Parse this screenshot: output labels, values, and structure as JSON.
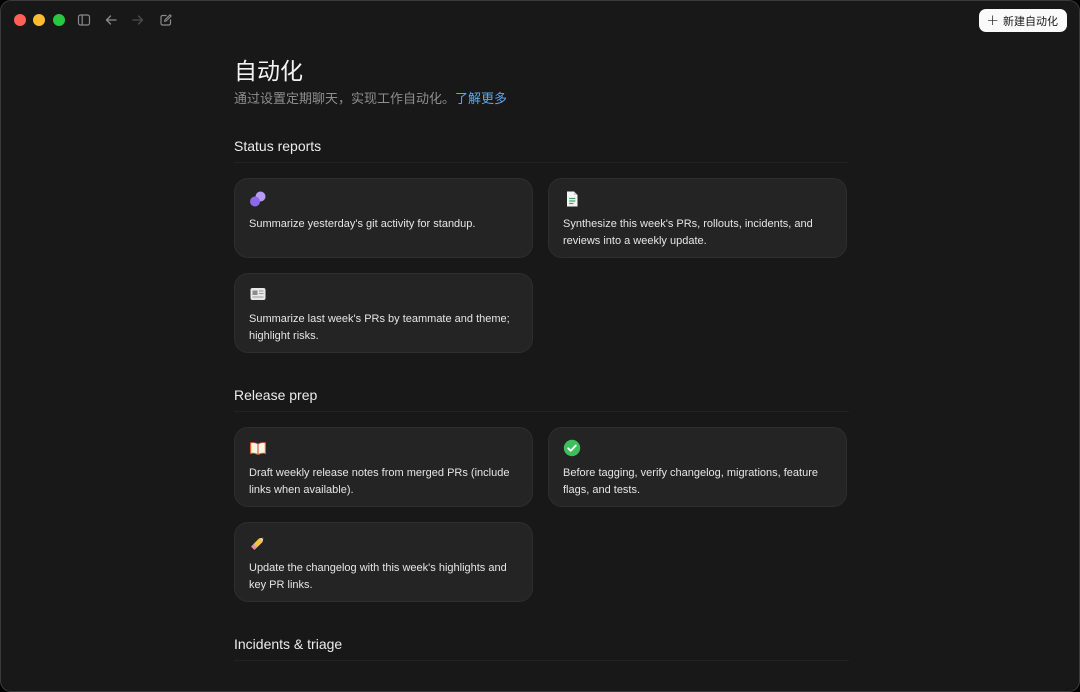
{
  "header": {
    "new_button_label": "新建自动化"
  },
  "page": {
    "title": "自动化",
    "subtitle": "通过设置定期聊天，实现工作自动化。",
    "learn_more": "了解更多"
  },
  "sections": [
    {
      "title": "Status reports",
      "cards": [
        {
          "icon": "chat-bubbles-icon",
          "text": "Summarize yesterday's git activity for standup."
        },
        {
          "icon": "document-icon",
          "text": "Synthesize this week's PRs, rollouts, incidents, and reviews into a weekly update."
        },
        {
          "icon": "newspaper-icon",
          "text": "Summarize last week's PRs by teammate and theme; highlight risks."
        }
      ]
    },
    {
      "title": "Release prep",
      "cards": [
        {
          "icon": "open-book-icon",
          "text": "Draft weekly release notes from merged PRs (include links when available)."
        },
        {
          "icon": "check-circle-icon",
          "text": "Before tagging, verify changelog, migrations, feature flags, and tests."
        },
        {
          "icon": "pencil-icon",
          "text": "Update the changelog with this week's highlights and key PR links."
        }
      ]
    },
    {
      "title": "Incidents & triage",
      "cards": []
    }
  ],
  "colors": {
    "background": "#181818",
    "card": "#242424",
    "accent_link": "#5aa7f5",
    "new_button_bg": "#fafafa"
  }
}
